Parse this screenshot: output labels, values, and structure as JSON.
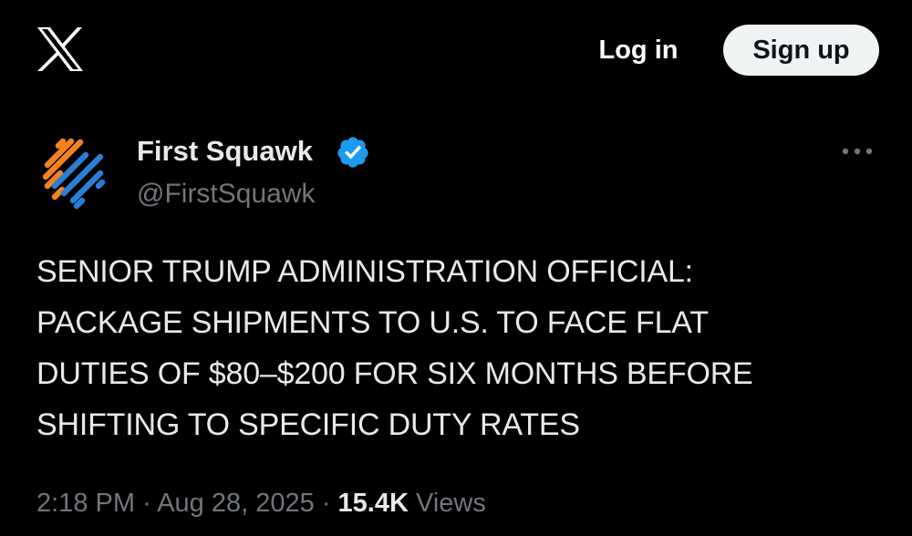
{
  "header": {
    "logo_icon": "x-logo-icon",
    "login_label": "Log in",
    "signup_label": "Sign up"
  },
  "tweet": {
    "author_name": "First Squawk",
    "author_handle": "@FirstSquawk",
    "verified_icon": "verified-badge-icon",
    "verified_color": "#1d9bf0",
    "more_icon": "more-options-icon",
    "lines": [
      "SENIOR TRUMP ADMINISTRATION OFFICIAL:",
      "PACKAGE SHIPMENTS TO U.S. TO FACE FLAT",
      "DUTIES OF $80–$200 FOR SIX MONTHS BEFORE",
      "SHIFTING TO SPECIFIC DUTY RATES"
    ],
    "time": "2:18 PM",
    "date": "Aug 28, 2025",
    "separator": "·",
    "views_count": "15.4K",
    "views_label": "Views"
  },
  "colors": {
    "background": "#000000",
    "text_primary": "#e7e9ea",
    "text_secondary": "#71767b",
    "avatar_orange": "#f5821f",
    "avatar_blue": "#2a7fd4"
  }
}
